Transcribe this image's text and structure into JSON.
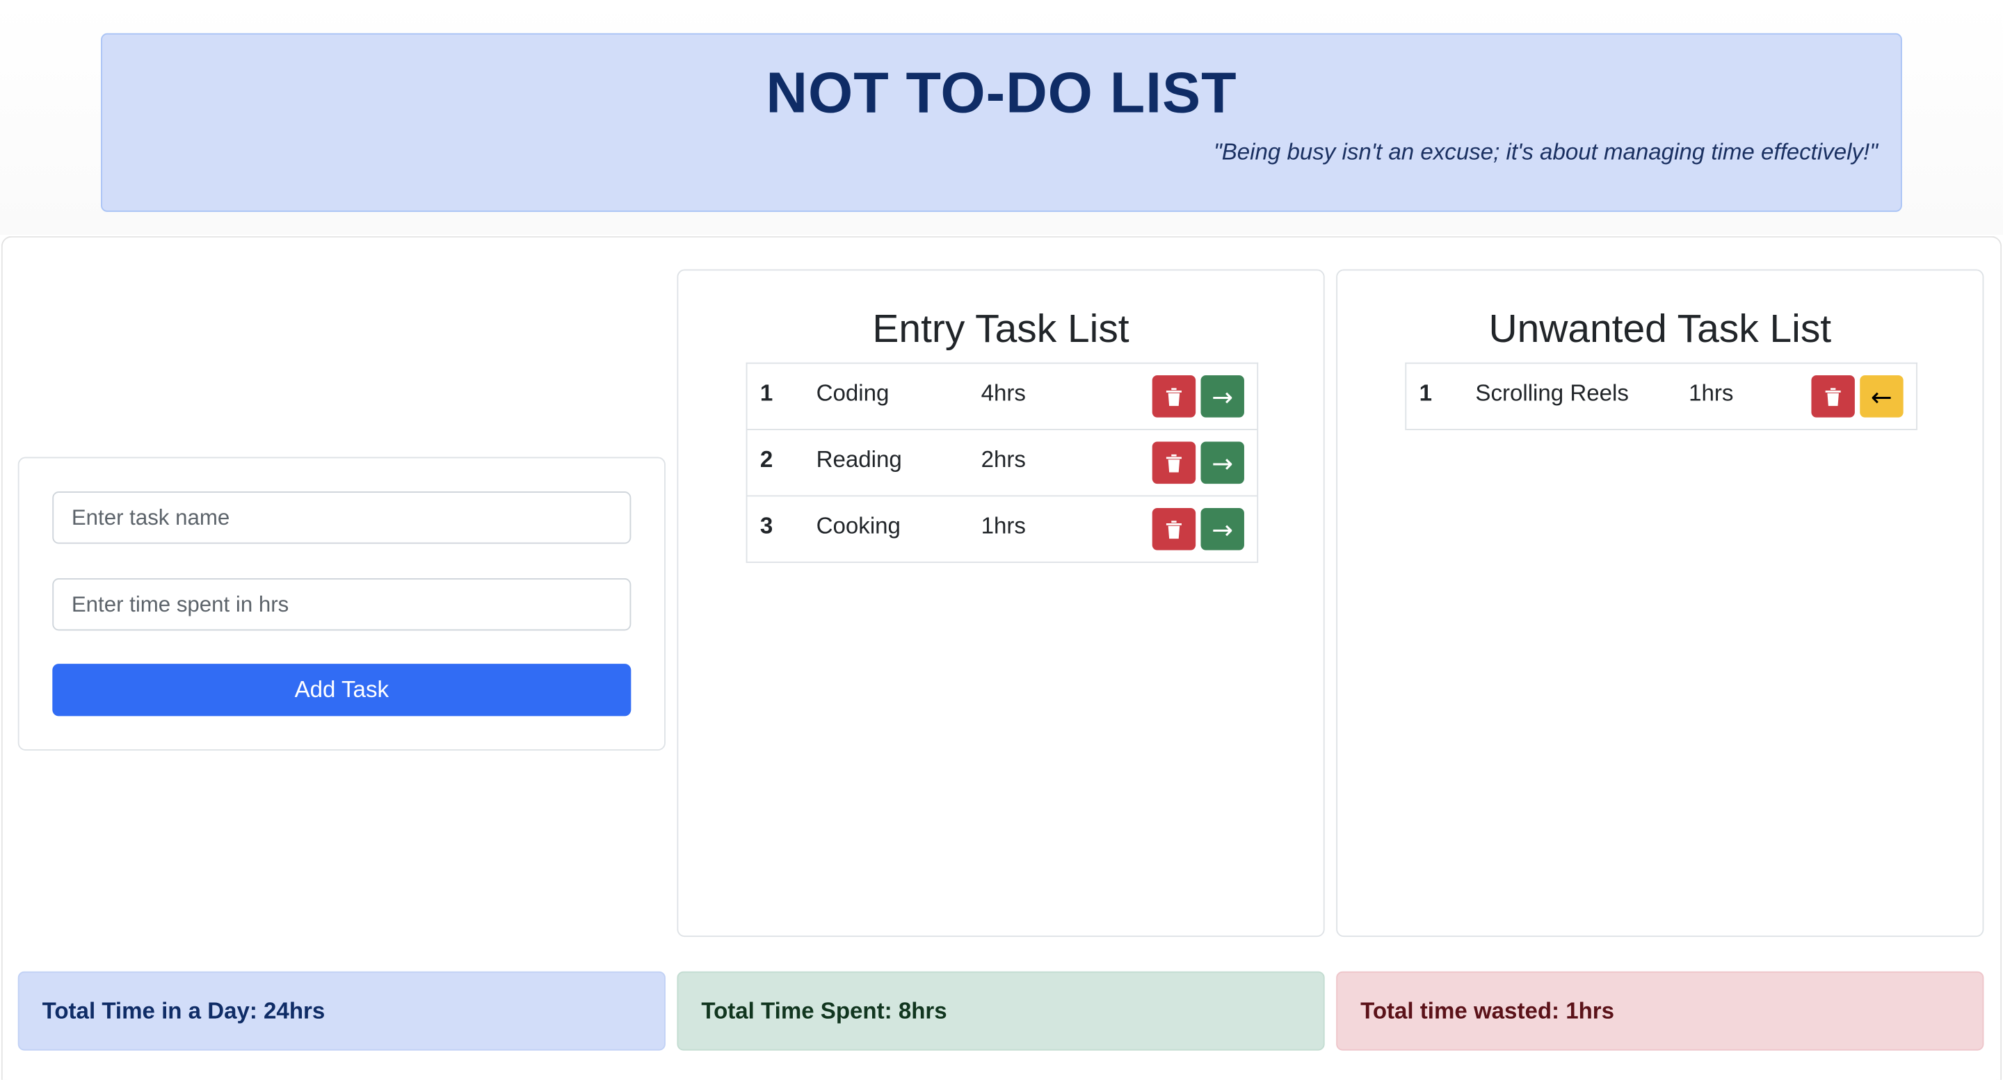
{
  "header": {
    "title": "NOT TO-DO LIST",
    "quote": "\"Being busy isn't an excuse; it's about managing time effectively!\""
  },
  "form": {
    "task_placeholder": "Enter task name",
    "time_placeholder": "Enter time spent in hrs",
    "add_button_label": "Add Task"
  },
  "entry_list": {
    "title": "Entry Task List",
    "tasks": [
      {
        "num": "1",
        "name": "Coding",
        "hrs": "4hrs"
      },
      {
        "num": "2",
        "name": "Reading",
        "hrs": "2hrs"
      },
      {
        "num": "3",
        "name": "Cooking",
        "hrs": "1hrs"
      }
    ],
    "move_glyph": "→"
  },
  "unwanted_list": {
    "title": "Unwanted Task List",
    "tasks": [
      {
        "num": "1",
        "name": "Scrolling Reels",
        "hrs": "1hrs"
      }
    ],
    "back_glyph": "←"
  },
  "summary": {
    "total_day": "Total Time in a Day: 24hrs",
    "total_spent": "Total Time Spent: 8hrs",
    "total_wasted": "Total time wasted: 1hrs"
  },
  "colors": {
    "header_bg": "#d2ddf9",
    "primary": "#316cf4",
    "danger": "#ca3b43",
    "success": "#3d8457",
    "warning": "#f4c13a"
  },
  "icons": {
    "delete": "trash-icon",
    "move": "arrow-right-icon",
    "back": "arrow-left-icon"
  }
}
